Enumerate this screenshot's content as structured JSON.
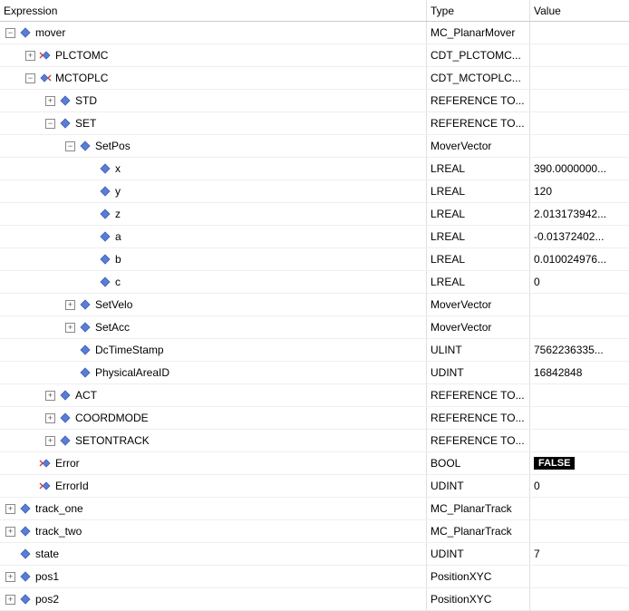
{
  "columns": {
    "expr": "Expression",
    "type": "Type",
    "value": "Value"
  },
  "rows": [
    {
      "level": 0,
      "toggle": "-",
      "icon": "struct-diamond",
      "name": "mover",
      "type": "MC_PlanarMover",
      "value": ""
    },
    {
      "level": 1,
      "toggle": "+",
      "icon": "io-out",
      "name": "PLCTOMC",
      "type": "CDT_PLCTOMC...",
      "value": ""
    },
    {
      "level": 1,
      "toggle": "-",
      "icon": "io-in",
      "name": "MCTOPLC",
      "type": "CDT_MCTOPLC...",
      "value": ""
    },
    {
      "level": 2,
      "toggle": "+",
      "icon": "struct-diamond",
      "name": "STD",
      "type": "REFERENCE TO...",
      "value": ""
    },
    {
      "level": 2,
      "toggle": "-",
      "icon": "struct-diamond",
      "name": "SET",
      "type": "REFERENCE TO...",
      "value": ""
    },
    {
      "level": 3,
      "toggle": "-",
      "icon": "struct-diamond",
      "name": "SetPos",
      "type": "MoverVector",
      "value": ""
    },
    {
      "level": 4,
      "toggle": "",
      "icon": "scalar-diamond",
      "name": "x",
      "type": "LREAL",
      "value": "390.0000000..."
    },
    {
      "level": 4,
      "toggle": "",
      "icon": "scalar-diamond",
      "name": "y",
      "type": "LREAL",
      "value": "120"
    },
    {
      "level": 4,
      "toggle": "",
      "icon": "scalar-diamond",
      "name": "z",
      "type": "LREAL",
      "value": "2.013173942..."
    },
    {
      "level": 4,
      "toggle": "",
      "icon": "scalar-diamond",
      "name": "a",
      "type": "LREAL",
      "value": "-0.01372402..."
    },
    {
      "level": 4,
      "toggle": "",
      "icon": "scalar-diamond",
      "name": "b",
      "type": "LREAL",
      "value": "0.010024976..."
    },
    {
      "level": 4,
      "toggle": "",
      "icon": "scalar-diamond",
      "name": "c",
      "type": "LREAL",
      "value": "0"
    },
    {
      "level": 3,
      "toggle": "+",
      "icon": "struct-diamond",
      "name": "SetVelo",
      "type": "MoverVector",
      "value": ""
    },
    {
      "level": 3,
      "toggle": "+",
      "icon": "struct-diamond",
      "name": "SetAcc",
      "type": "MoverVector",
      "value": ""
    },
    {
      "level": 3,
      "toggle": "",
      "icon": "scalar-diamond",
      "name": "DcTimeStamp",
      "type": "ULINT",
      "value": "7562236335..."
    },
    {
      "level": 3,
      "toggle": "",
      "icon": "scalar-diamond",
      "name": "PhysicalAreaID",
      "type": "UDINT",
      "value": "16842848"
    },
    {
      "level": 2,
      "toggle": "+",
      "icon": "struct-diamond",
      "name": "ACT",
      "type": "REFERENCE TO...",
      "value": ""
    },
    {
      "level": 2,
      "toggle": "+",
      "icon": "struct-diamond",
      "name": "COORDMODE",
      "type": "REFERENCE TO...",
      "value": ""
    },
    {
      "level": 2,
      "toggle": "+",
      "icon": "struct-diamond",
      "name": "SETONTRACK",
      "type": "REFERENCE TO...",
      "value": ""
    },
    {
      "level": 1,
      "toggle": "",
      "icon": "io-out",
      "name": "Error",
      "type": "BOOL",
      "value": "FALSE",
      "boolFalse": true
    },
    {
      "level": 1,
      "toggle": "",
      "icon": "io-out",
      "name": "ErrorId",
      "type": "UDINT",
      "value": "0"
    },
    {
      "level": 0,
      "toggle": "+",
      "icon": "struct-diamond",
      "name": "track_one",
      "type": "MC_PlanarTrack",
      "value": ""
    },
    {
      "level": 0,
      "toggle": "+",
      "icon": "struct-diamond",
      "name": "track_two",
      "type": "MC_PlanarTrack",
      "value": ""
    },
    {
      "level": 0,
      "toggle": "",
      "icon": "struct-diamond",
      "name": "state",
      "type": "UDINT",
      "value": "7"
    },
    {
      "level": 0,
      "toggle": "+",
      "icon": "struct-diamond",
      "name": "pos1",
      "type": "PositionXYC",
      "value": ""
    },
    {
      "level": 0,
      "toggle": "+",
      "icon": "struct-diamond",
      "name": "pos2",
      "type": "PositionXYC",
      "value": ""
    }
  ]
}
